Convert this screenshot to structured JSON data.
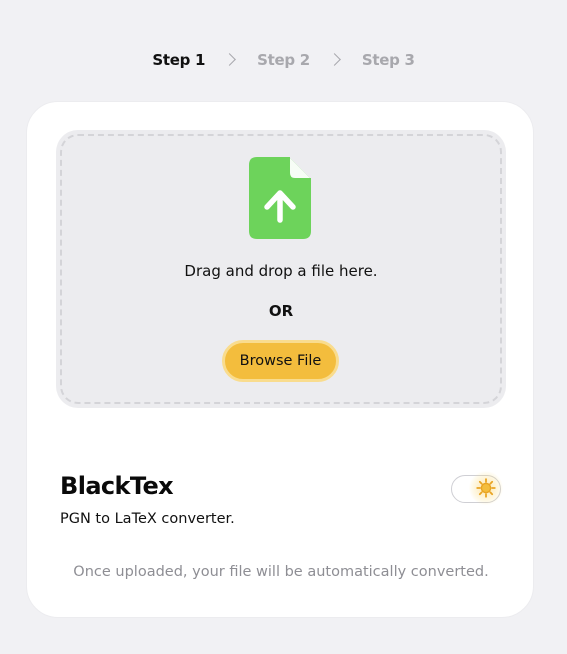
{
  "stepper": {
    "steps": [
      {
        "label": "Step 1",
        "active": true
      },
      {
        "label": "Step 2",
        "active": false
      },
      {
        "label": "Step 3",
        "active": false
      }
    ]
  },
  "upload": {
    "icon": "file-upload-icon",
    "icon_color": "#6dd35b",
    "drop_text": "Drag and drop a file here.",
    "or_text": "OR",
    "browse_label": "Browse File",
    "browse_color": "#f3bd3d"
  },
  "app": {
    "title": "BlackTex",
    "subtitle": "PGN to LaTeX converter."
  },
  "theme_toggle": {
    "icon": "sun-icon",
    "state": "light"
  },
  "footer": {
    "note": "Once uploaded, your file will be automatically converted."
  }
}
